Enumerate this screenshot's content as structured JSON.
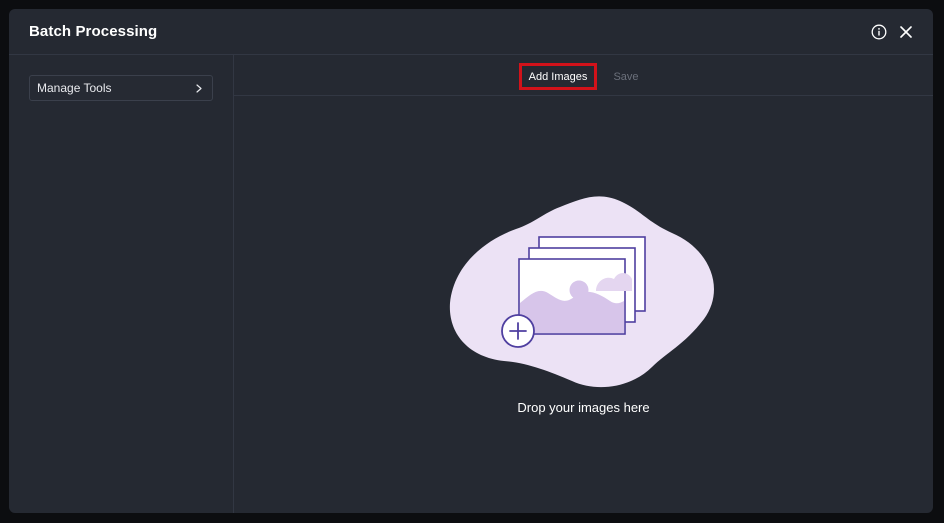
{
  "modal": {
    "title": "Batch Processing",
    "icons": [
      "info-icon",
      "close-icon"
    ]
  },
  "sidebar": {
    "items": [
      {
        "label": "Manage Tools",
        "icon": "chevron-right-icon"
      }
    ]
  },
  "toolbar": {
    "add_images_label": "Add Images",
    "save_label": "Save"
  },
  "dropzone": {
    "text": "Drop your images here",
    "icon": "add-images-illustration"
  },
  "colors": {
    "background": "#252932",
    "highlight": "#d2121a",
    "illustration_blob": "#ece2f5",
    "illustration_stroke": "#4f3fa0",
    "disabled_text": "#6b707b"
  }
}
